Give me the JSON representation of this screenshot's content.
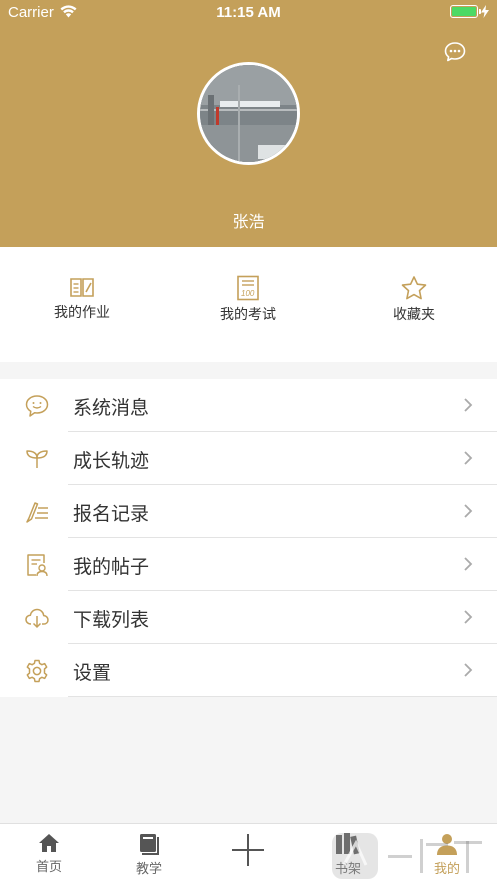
{
  "status_bar": {
    "carrier": "Carrier",
    "time": "11:15 AM"
  },
  "profile": {
    "username": "张浩"
  },
  "quick_actions": [
    {
      "label": "我的作业",
      "icon": "homework-book-icon"
    },
    {
      "label": "我的考试",
      "icon": "exam-paper-icon"
    },
    {
      "label": "收藏夹",
      "icon": "star-icon"
    }
  ],
  "menu": [
    {
      "label": "系统消息",
      "icon": "message-bubble-icon"
    },
    {
      "label": "成长轨迹",
      "icon": "sprout-icon"
    },
    {
      "label": "报名记录",
      "icon": "pen-list-icon"
    },
    {
      "label": "我的帖子",
      "icon": "post-user-icon"
    },
    {
      "label": "下载列表",
      "icon": "cloud-download-icon"
    },
    {
      "label": "设置",
      "icon": "gear-icon"
    }
  ],
  "tabbar": {
    "items": [
      {
        "label": "首页",
        "icon": "home-icon"
      },
      {
        "label": "教学",
        "icon": "book-icon"
      },
      {
        "label": "",
        "icon": "plus-icon"
      },
      {
        "label": "书架",
        "icon": "bookshelf-icon"
      },
      {
        "label": "我的",
        "icon": "person-icon"
      }
    ],
    "active_index": 4
  },
  "colors": {
    "accent": "#c4a05a",
    "battery": "#4cd964"
  }
}
